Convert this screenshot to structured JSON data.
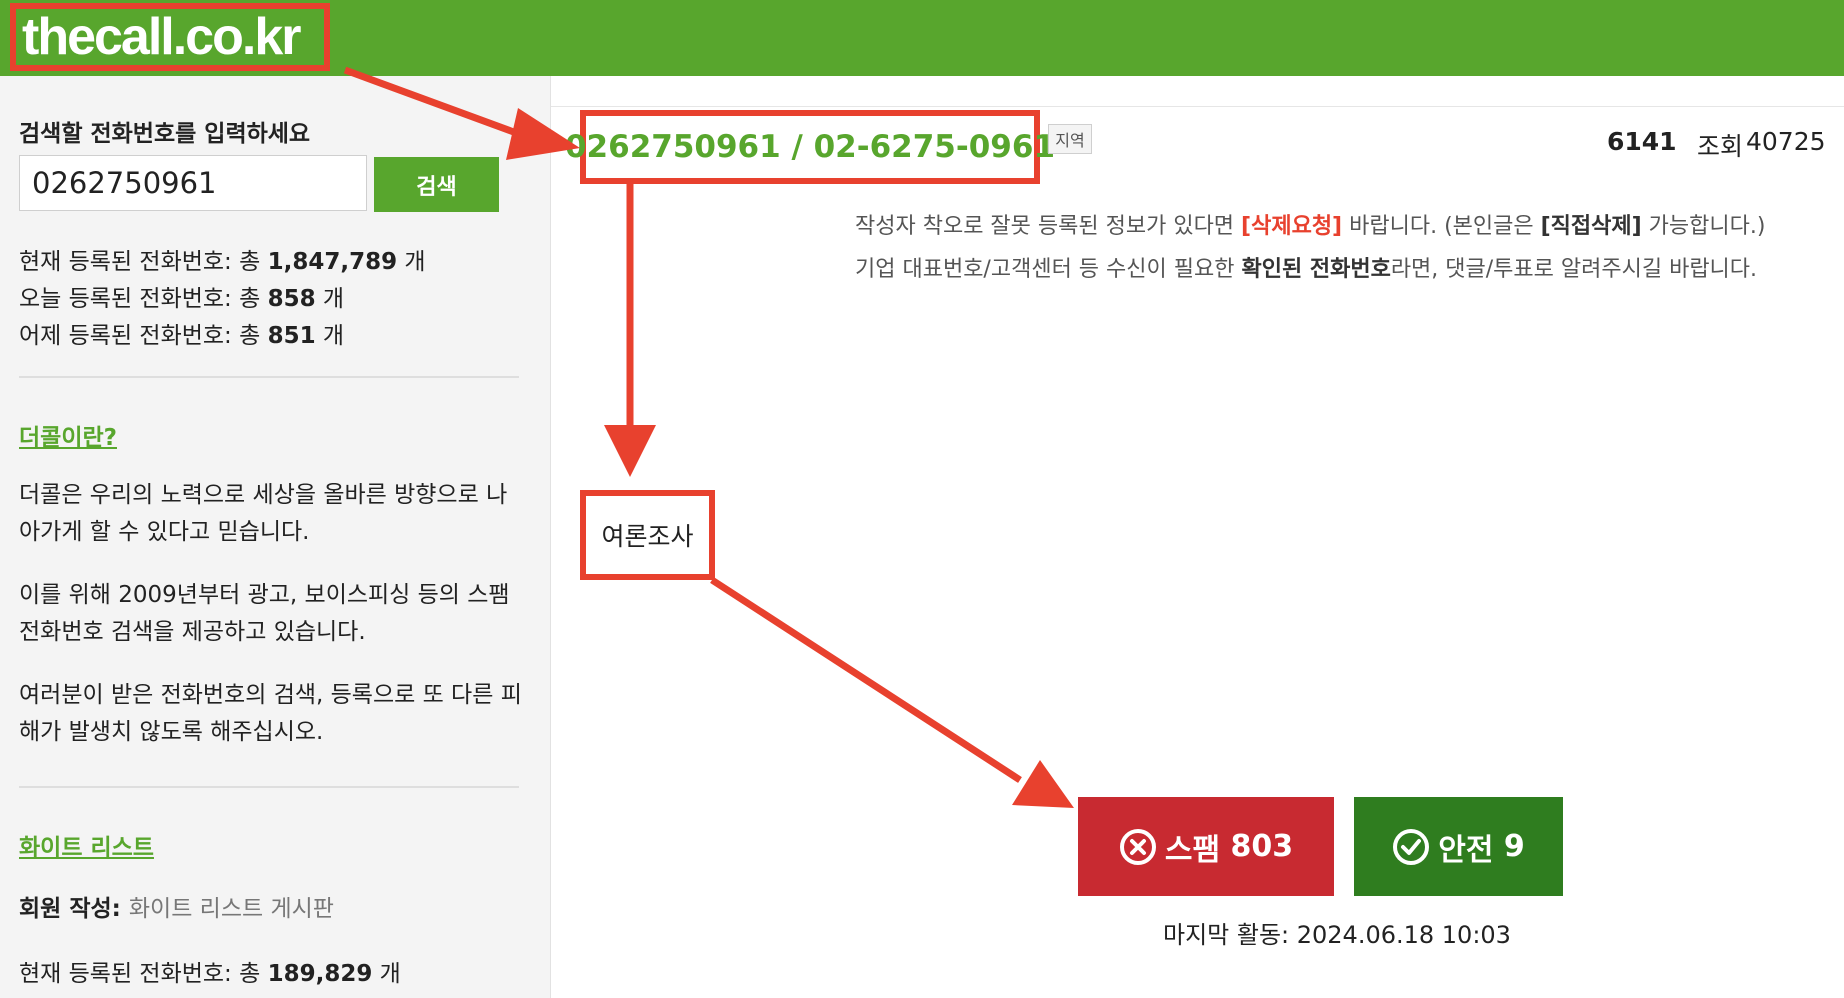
{
  "header": {
    "logo": "thecall.co.kr"
  },
  "sidebar": {
    "search_label": "검색할 전화번호를 입력하세요",
    "search_value": "0262750961",
    "search_button": "검색",
    "stats": [
      {
        "prefix": "현재 등록된 전화번호: 총 ",
        "count": "1,847,789",
        "suffix": " 개"
      },
      {
        "prefix": "오늘 등록된 전화번호: 총 ",
        "count": "858",
        "suffix": " 개"
      },
      {
        "prefix": "어제 등록된 전화번호: 총 ",
        "count": "851",
        "suffix": " 개"
      }
    ],
    "about_link": "더콜이란?",
    "about_paragraphs": [
      "더콜은 우리의 노력으로 세상을 올바른 방향으로 나아가게 할 수 있다고 믿습니다.",
      "이를 위해 2009년부터 광고, 보이스피싱 등의 스팸 전화번호 검색을 제공하고 있습니다.",
      "여러분이 받은 전화번호의 검색, 등록으로 또 다른 피해가 발생치 않도록 해주십시오."
    ],
    "whitelist_link": "화이트 리스트",
    "whitelist_member_label": "회원 작성",
    "whitelist_colon": ": ",
    "whitelist_board": "화이트 리스트 게시판",
    "whitelist_stat": {
      "prefix": "현재 등록된 전화번호: 총 ",
      "count": "189,829",
      "suffix": " 개"
    }
  },
  "main": {
    "phone": "0262750961  /  02-6275-0961",
    "region_badge": "지역",
    "post_id": "6141",
    "views_label": "조회",
    "views_count": "40725",
    "notice_line1": {
      "a": "작성자 착오로 잘못 등록된 정보가 있다면 ",
      "delete_request": "[삭제요청]",
      "b": " 바랍니다. (본인글은 ",
      "self_delete": "[직접삭제]",
      "c": " 가능합니다.)"
    },
    "notice_line2": {
      "a": "기업 대표번호/고객센터 등 수신이 필요한 ",
      "bold": "확인된 전화번호",
      "b": "라면, 댓글/투표로 알려주시길 바랍니다."
    },
    "category": "여론조사",
    "vote_spam": {
      "label": "스팸",
      "count": "803"
    },
    "vote_safe": {
      "label": "안전",
      "count": "9"
    },
    "last_activity": "마지막 활동: 2024.06.18 10:03"
  },
  "colors": {
    "brand_green": "#58a62d",
    "annotation_red": "#e8412e",
    "spam_red": "#c82a31",
    "safe_green": "#2f7d1f"
  },
  "icons": {
    "spam": "x-circle-icon",
    "safe": "check-circle-icon"
  }
}
